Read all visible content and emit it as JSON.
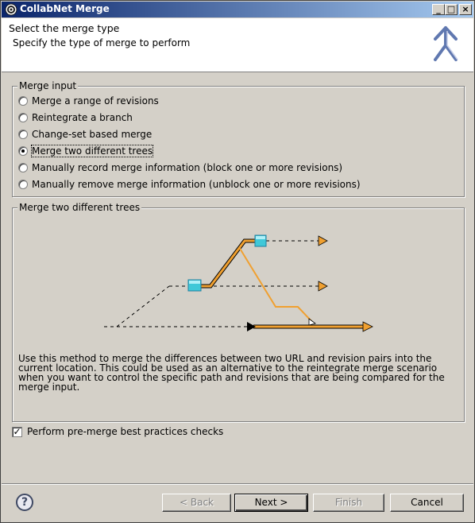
{
  "window": {
    "title": "CollabNet Merge",
    "controls": [
      "_",
      "□",
      "×"
    ]
  },
  "header": {
    "title": "Select the merge type",
    "description": "Specify the type of merge to perform",
    "icon": "merge-arrows-icon"
  },
  "merge_input": {
    "label": "Merge input",
    "options": [
      {
        "label": "Merge a range of revisions",
        "checked": false
      },
      {
        "label": "Reintegrate a branch",
        "checked": false
      },
      {
        "label": "Change-set based merge",
        "checked": false
      },
      {
        "label": "Merge two different trees",
        "checked": true
      },
      {
        "label": "Manually record merge information (block one or more revisions)",
        "checked": false
      },
      {
        "label": "Manually remove merge information (unblock one or more revisions)",
        "checked": false
      }
    ]
  },
  "details": {
    "label": "Merge two different trees",
    "description": "Use this method to merge the differences between two URL and revision pairs into the current location.  This could be used as an alternative to the reintegrate merge scenario when you want to control the specific path and revisions that are being compared for the merge input.",
    "diagram_colors": {
      "accent": "#f0a030",
      "node": "#40c8d8",
      "line": "#000000"
    }
  },
  "best_practices": {
    "label": "Perform pre-merge best practices checks",
    "checked": true
  },
  "buttons": {
    "help": "?",
    "back": "< Back",
    "next": "Next >",
    "finish": "Finish",
    "cancel": "Cancel"
  }
}
